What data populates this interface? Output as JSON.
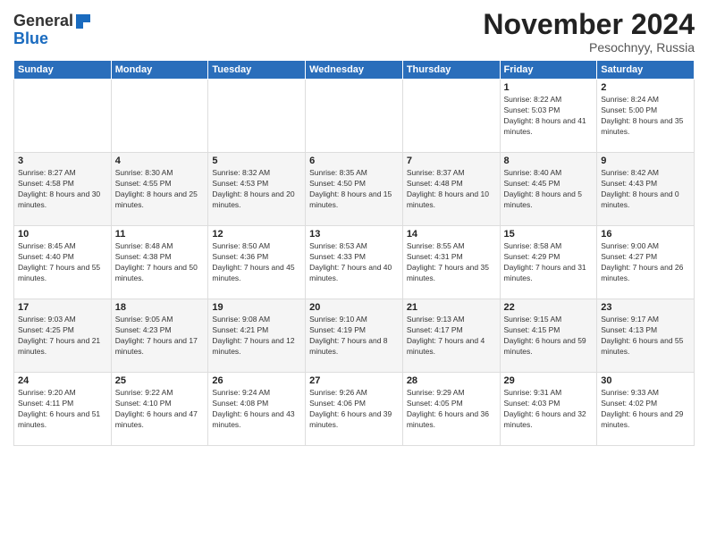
{
  "logo": {
    "general": "General",
    "blue": "Blue"
  },
  "header": {
    "month": "November 2024",
    "location": "Pesochnyy, Russia"
  },
  "weekdays": [
    "Sunday",
    "Monday",
    "Tuesday",
    "Wednesday",
    "Thursday",
    "Friday",
    "Saturday"
  ],
  "weeks": [
    [
      {
        "day": "",
        "info": ""
      },
      {
        "day": "",
        "info": ""
      },
      {
        "day": "",
        "info": ""
      },
      {
        "day": "",
        "info": ""
      },
      {
        "day": "",
        "info": ""
      },
      {
        "day": "1",
        "info": "Sunrise: 8:22 AM\nSunset: 5:03 PM\nDaylight: 8 hours and 41 minutes."
      },
      {
        "day": "2",
        "info": "Sunrise: 8:24 AM\nSunset: 5:00 PM\nDaylight: 8 hours and 35 minutes."
      }
    ],
    [
      {
        "day": "3",
        "info": "Sunrise: 8:27 AM\nSunset: 4:58 PM\nDaylight: 8 hours and 30 minutes."
      },
      {
        "day": "4",
        "info": "Sunrise: 8:30 AM\nSunset: 4:55 PM\nDaylight: 8 hours and 25 minutes."
      },
      {
        "day": "5",
        "info": "Sunrise: 8:32 AM\nSunset: 4:53 PM\nDaylight: 8 hours and 20 minutes."
      },
      {
        "day": "6",
        "info": "Sunrise: 8:35 AM\nSunset: 4:50 PM\nDaylight: 8 hours and 15 minutes."
      },
      {
        "day": "7",
        "info": "Sunrise: 8:37 AM\nSunset: 4:48 PM\nDaylight: 8 hours and 10 minutes."
      },
      {
        "day": "8",
        "info": "Sunrise: 8:40 AM\nSunset: 4:45 PM\nDaylight: 8 hours and 5 minutes."
      },
      {
        "day": "9",
        "info": "Sunrise: 8:42 AM\nSunset: 4:43 PM\nDaylight: 8 hours and 0 minutes."
      }
    ],
    [
      {
        "day": "10",
        "info": "Sunrise: 8:45 AM\nSunset: 4:40 PM\nDaylight: 7 hours and 55 minutes."
      },
      {
        "day": "11",
        "info": "Sunrise: 8:48 AM\nSunset: 4:38 PM\nDaylight: 7 hours and 50 minutes."
      },
      {
        "day": "12",
        "info": "Sunrise: 8:50 AM\nSunset: 4:36 PM\nDaylight: 7 hours and 45 minutes."
      },
      {
        "day": "13",
        "info": "Sunrise: 8:53 AM\nSunset: 4:33 PM\nDaylight: 7 hours and 40 minutes."
      },
      {
        "day": "14",
        "info": "Sunrise: 8:55 AM\nSunset: 4:31 PM\nDaylight: 7 hours and 35 minutes."
      },
      {
        "day": "15",
        "info": "Sunrise: 8:58 AM\nSunset: 4:29 PM\nDaylight: 7 hours and 31 minutes."
      },
      {
        "day": "16",
        "info": "Sunrise: 9:00 AM\nSunset: 4:27 PM\nDaylight: 7 hours and 26 minutes."
      }
    ],
    [
      {
        "day": "17",
        "info": "Sunrise: 9:03 AM\nSunset: 4:25 PM\nDaylight: 7 hours and 21 minutes."
      },
      {
        "day": "18",
        "info": "Sunrise: 9:05 AM\nSunset: 4:23 PM\nDaylight: 7 hours and 17 minutes."
      },
      {
        "day": "19",
        "info": "Sunrise: 9:08 AM\nSunset: 4:21 PM\nDaylight: 7 hours and 12 minutes."
      },
      {
        "day": "20",
        "info": "Sunrise: 9:10 AM\nSunset: 4:19 PM\nDaylight: 7 hours and 8 minutes."
      },
      {
        "day": "21",
        "info": "Sunrise: 9:13 AM\nSunset: 4:17 PM\nDaylight: 7 hours and 4 minutes."
      },
      {
        "day": "22",
        "info": "Sunrise: 9:15 AM\nSunset: 4:15 PM\nDaylight: 6 hours and 59 minutes."
      },
      {
        "day": "23",
        "info": "Sunrise: 9:17 AM\nSunset: 4:13 PM\nDaylight: 6 hours and 55 minutes."
      }
    ],
    [
      {
        "day": "24",
        "info": "Sunrise: 9:20 AM\nSunset: 4:11 PM\nDaylight: 6 hours and 51 minutes."
      },
      {
        "day": "25",
        "info": "Sunrise: 9:22 AM\nSunset: 4:10 PM\nDaylight: 6 hours and 47 minutes."
      },
      {
        "day": "26",
        "info": "Sunrise: 9:24 AM\nSunset: 4:08 PM\nDaylight: 6 hours and 43 minutes."
      },
      {
        "day": "27",
        "info": "Sunrise: 9:26 AM\nSunset: 4:06 PM\nDaylight: 6 hours and 39 minutes."
      },
      {
        "day": "28",
        "info": "Sunrise: 9:29 AM\nSunset: 4:05 PM\nDaylight: 6 hours and 36 minutes."
      },
      {
        "day": "29",
        "info": "Sunrise: 9:31 AM\nSunset: 4:03 PM\nDaylight: 6 hours and 32 minutes."
      },
      {
        "day": "30",
        "info": "Sunrise: 9:33 AM\nSunset: 4:02 PM\nDaylight: 6 hours and 29 minutes."
      }
    ]
  ]
}
